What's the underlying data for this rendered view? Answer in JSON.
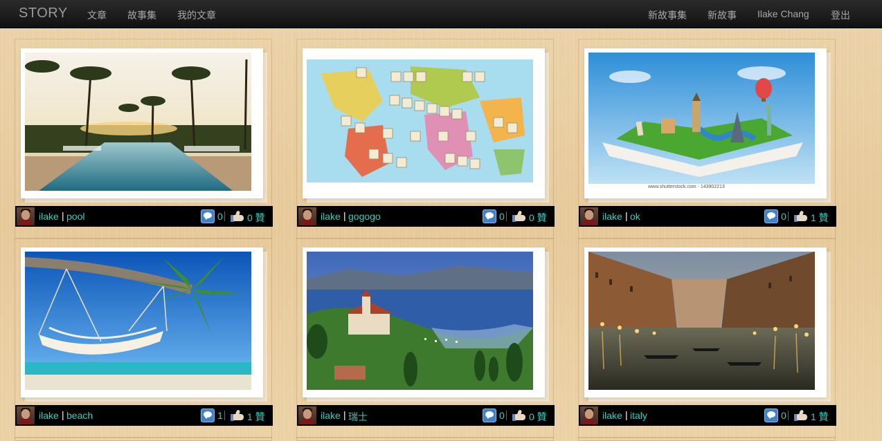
{
  "navbar": {
    "brand": "STORY",
    "left_items": [
      "文章",
      "故事集",
      "我的文章"
    ],
    "right_items": [
      "新故事集",
      "新故事",
      "Ilake Chang",
      "登出"
    ]
  },
  "colors": {
    "link": "#2fd0c0",
    "navbar": "#1a1a1a",
    "background": "#e9cfa3"
  },
  "stories": [
    {
      "author": "ilake",
      "separator": "|",
      "title": "pool",
      "comments": "0",
      "likes": "0 贊",
      "image": "pool-with-palm-trees"
    },
    {
      "author": "ilake",
      "separator": "|",
      "title": "gogogo",
      "comments": "0",
      "likes": "0 贊",
      "image": "i-want-to-travel-around-the-world-map"
    },
    {
      "author": "ilake",
      "separator": "|",
      "title": "ok",
      "comments": "0",
      "likes": "1 贊",
      "image": "pop-up-book-landmarks"
    },
    {
      "author": "ilake",
      "separator": "|",
      "title": "beach",
      "comments": "1",
      "likes": "1 贊",
      "image": "hammock-on-palm-tree-beach"
    },
    {
      "author": "ilake",
      "separator": "|",
      "title": "瑞士",
      "comments": "0",
      "likes": "0 贊",
      "image": "swiss-lake-castle"
    },
    {
      "author": "ilake",
      "separator": "|",
      "title": "italy",
      "comments": "0",
      "likes": "1 贊",
      "image": "venice-grand-canal"
    }
  ]
}
